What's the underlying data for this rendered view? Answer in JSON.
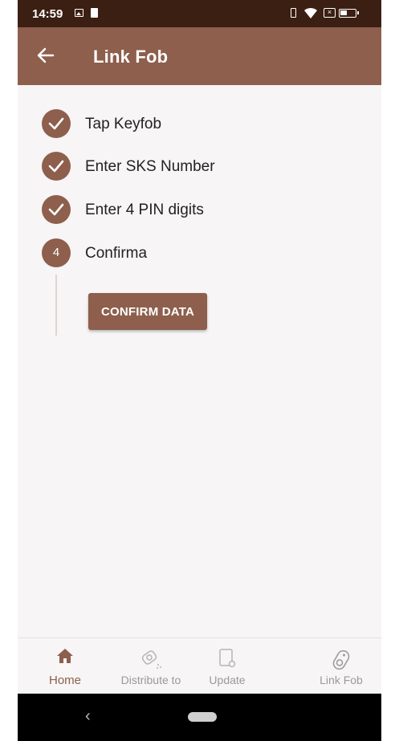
{
  "status_bar": {
    "time": "14:59",
    "icons": [
      "gallery-icon",
      "sim-icon",
      "vibrate-icon",
      "wifi-icon",
      "no-sim-icon",
      "battery-icon"
    ]
  },
  "app_bar": {
    "title": "Link Fob",
    "back_icon": "arrow-left-icon",
    "background": "#8d5f4c"
  },
  "stepper": {
    "steps": [
      {
        "label": "Tap Keyfob",
        "state": "done"
      },
      {
        "label": "Enter SKS Number",
        "state": "done"
      },
      {
        "label": "Enter 4 PIN digits",
        "state": "done"
      },
      {
        "label": "Confirma",
        "state": "active",
        "number": "4"
      }
    ],
    "confirm_button_label": "CONFIRM DATA"
  },
  "bottom_nav": {
    "items": [
      {
        "label": "Home",
        "icon": "home-icon",
        "active": true
      },
      {
        "label": "Distribute to",
        "icon": "distribute-icon",
        "active": false
      },
      {
        "label": "Update",
        "icon": "update-icon",
        "active": false
      },
      {
        "label": "Link Fob",
        "icon": "keyfob-icon",
        "active": false
      }
    ]
  },
  "colors": {
    "accent": "#8d5f4c",
    "status_bar": "#3b1f12",
    "background": "#f7f5f5"
  }
}
